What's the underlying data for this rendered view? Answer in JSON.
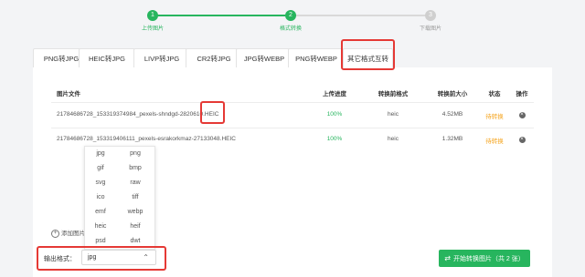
{
  "stepper": {
    "steps": [
      {
        "num": "1",
        "label": "上传图片"
      },
      {
        "num": "2",
        "label": "格式转换"
      },
      {
        "num": "3",
        "label": "下载图片"
      }
    ]
  },
  "tabs": [
    "PNG转JPG",
    "HEIC转JPG",
    "LIVP转JPG",
    "CR2转JPG",
    "JPG转WEBP",
    "PNG转WEBP",
    "其它格式互转"
  ],
  "table": {
    "headers": {
      "name": "图片文件",
      "progress": "上传进度",
      "from_format": "转换前格式",
      "size": "转换前大小",
      "status": "状态",
      "action": "操作"
    },
    "rows": [
      {
        "name": "21784686728_153319374984_pexels-shndgd-2820610.HEIC",
        "progress": "100%",
        "from_format": "heic",
        "size": "4.52MB",
        "status": "待转换",
        "action": "delete-icon"
      },
      {
        "name": "21784686728_153319406111_pexels-esrakorkmaz-27133048.HEIC",
        "progress": "100%",
        "from_format": "heic",
        "size": "1.32MB",
        "status": "待转换",
        "action": "delete-icon"
      }
    ]
  },
  "dropdown": {
    "options": [
      "jpg",
      "png",
      "gif",
      "bmp",
      "svg",
      "raw",
      "ico",
      "tiff",
      "emf",
      "webp",
      "heic",
      "heif",
      "psd",
      "dwt"
    ]
  },
  "add_image": "添加图片",
  "format": {
    "label": "输出格式：",
    "value": "jpg"
  },
  "convert_button": "开始转换图片（共 2 张）",
  "colors": {
    "accent": "#27b55e",
    "pending": "#f5a623",
    "highlight": "#e53935"
  }
}
